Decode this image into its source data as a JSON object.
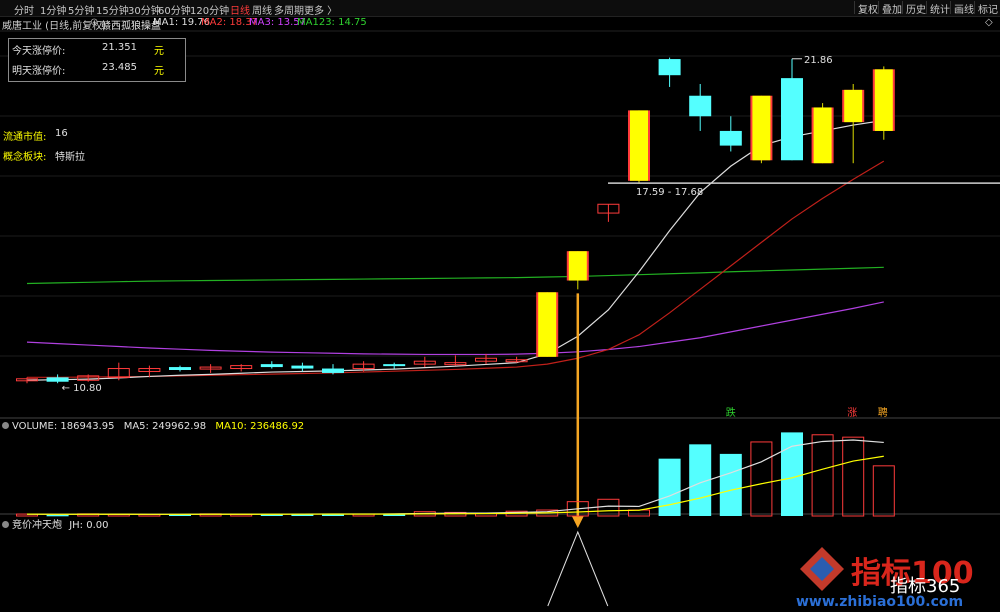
{
  "toolbar": {
    "periods": [
      {
        "label": "分时",
        "active": false
      },
      {
        "label": "1分钟",
        "active": false
      },
      {
        "label": "5分钟",
        "active": false
      },
      {
        "label": "15分钟",
        "active": false
      },
      {
        "label": "30分钟",
        "active": false
      },
      {
        "label": "60分钟",
        "active": false
      },
      {
        "label": "120分钟",
        "active": false
      },
      {
        "label": "日线",
        "active": true
      },
      {
        "label": "周线",
        "active": false
      },
      {
        "label": "多周期",
        "active": false
      },
      {
        "label": "更多 〉",
        "active": false
      }
    ],
    "right_buttons": [
      "复权",
      "叠加",
      "历史",
      "统计",
      "画线",
      "标记"
    ]
  },
  "header": {
    "stock_name": "威唐工业 (日线,前复权)",
    "indicator_name": "赣西孤狼操盘",
    "ma1": "MA1: 19.76",
    "ma2": "MA2: 18.37",
    "ma3": "MA3: 13.57",
    "ma123": "MA123: 14.75",
    "close_symbol": "◇"
  },
  "price_box": {
    "today_label": "今天涨停价:",
    "today_value": "21.351",
    "today_unit": "元",
    "tomorrow_label": "明天涨停价:",
    "tomorrow_value": "23.485",
    "tomorrow_unit": "元"
  },
  "side_info": {
    "float_cap_label": "流通市值:",
    "float_cap_value": "16",
    "concept_label": "概念板块:",
    "concept_value": "特斯拉"
  },
  "annotations": {
    "high_label": "21.86",
    "low_label": "10.80",
    "range_label": "17.59 - 17.68",
    "signal_die": "跌",
    "signal_zhang": "涨",
    "signal_mai": "聘"
  },
  "volume_header": {
    "volume": "VOLUME: 186943.95",
    "ma5": "MA5: 249962.98",
    "ma10": "MA10: 236486.92"
  },
  "indicator2_header": {
    "name": "竞价冲天炮",
    "value": "JH: 0.00"
  },
  "watermark": {
    "brand1": "指标100",
    "brand2": "指标365",
    "url": "www.zhibiao100.com"
  },
  "colors": {
    "up": "#ff3b3b",
    "down": "#54ffff",
    "ma1": "#dddddd",
    "ma2": "#c0201a",
    "ma3": "#b040e0",
    "ma123": "#22b022",
    "limit_up_fill": "#ffff00",
    "arrow": "#f5a623"
  },
  "chart_data": {
    "type": "candlestick",
    "candles": [
      {
        "o": 10.9,
        "h": 11.0,
        "l": 10.8,
        "c": 10.95
      },
      {
        "o": 11.0,
        "h": 11.1,
        "l": 10.8,
        "c": 10.85
      },
      {
        "o": 10.9,
        "h": 11.1,
        "l": 10.85,
        "c": 11.05
      },
      {
        "o": 11.0,
        "h": 11.5,
        "l": 10.9,
        "c": 11.3
      },
      {
        "o": 11.2,
        "h": 11.4,
        "l": 11.0,
        "c": 11.3
      },
      {
        "o": 11.35,
        "h": 11.4,
        "l": 11.2,
        "c": 11.25
      },
      {
        "o": 11.3,
        "h": 11.45,
        "l": 11.15,
        "c": 11.35
      },
      {
        "o": 11.3,
        "h": 11.45,
        "l": 11.2,
        "c": 11.4
      },
      {
        "o": 11.45,
        "h": 11.55,
        "l": 11.3,
        "c": 11.35
      },
      {
        "o": 11.4,
        "h": 11.5,
        "l": 11.2,
        "c": 11.3
      },
      {
        "o": 11.3,
        "h": 11.45,
        "l": 11.1,
        "c": 11.15
      },
      {
        "o": 11.3,
        "h": 11.55,
        "l": 11.2,
        "c": 11.45
      },
      {
        "o": 11.45,
        "h": 11.5,
        "l": 11.3,
        "c": 11.4
      },
      {
        "o": 11.45,
        "h": 11.7,
        "l": 11.35,
        "c": 11.55
      },
      {
        "o": 11.5,
        "h": 11.75,
        "l": 11.4,
        "c": 11.5
      },
      {
        "o": 11.55,
        "h": 11.8,
        "l": 11.45,
        "c": 11.65
      },
      {
        "o": 11.6,
        "h": 11.7,
        "l": 11.5,
        "c": 11.6
      },
      {
        "o": 11.7,
        "h": 13.9,
        "l": 11.7,
        "c": 13.9
      },
      {
        "o": 14.3,
        "h": 15.3,
        "l": 14.0,
        "c": 15.3
      },
      {
        "o": 16.6,
        "h": 16.9,
        "l": 16.3,
        "c": 16.9
      },
      {
        "o": 17.7,
        "h": 20.1,
        "l": 17.6,
        "c": 20.1
      },
      {
        "o": 21.85,
        "h": 21.9,
        "l": 20.9,
        "c": 21.3
      },
      {
        "o": 20.6,
        "h": 21.0,
        "l": 19.4,
        "c": 19.9
      },
      {
        "o": 19.4,
        "h": 19.9,
        "l": 18.7,
        "c": 18.9
      },
      {
        "o": 18.4,
        "h": 20.6,
        "l": 18.3,
        "c": 20.6
      },
      {
        "o": 21.2,
        "h": 21.86,
        "l": 18.4,
        "c": 18.4
      },
      {
        "o": 18.3,
        "h": 20.35,
        "l": 18.3,
        "c": 20.2
      },
      {
        "o": 19.7,
        "h": 21.0,
        "l": 18.3,
        "c": 20.8
      },
      {
        "o": 19.4,
        "h": 21.6,
        "l": 19.1,
        "c": 21.5
      }
    ],
    "ma1": [
      10.9,
      10.92,
      10.94,
      10.98,
      11.03,
      11.07,
      11.1,
      11.14,
      11.18,
      11.2,
      11.22,
      11.25,
      11.28,
      11.33,
      11.38,
      11.44,
      11.5,
      11.8,
      12.4,
      13.3,
      14.6,
      16.0,
      17.3,
      18.2,
      18.9,
      19.2,
      19.4,
      19.6,
      19.76
    ],
    "ma2": [
      11.0,
      11.0,
      11.01,
      11.02,
      11.03,
      11.05,
      11.07,
      11.09,
      11.11,
      11.13,
      11.15,
      11.18,
      11.21,
      11.24,
      11.27,
      11.31,
      11.35,
      11.45,
      11.65,
      11.95,
      12.45,
      13.2,
      14.0,
      14.8,
      15.6,
      16.4,
      17.1,
      17.75,
      18.37
    ],
    "ma3": [
      12.2,
      12.15,
      12.1,
      12.05,
      12.0,
      11.96,
      11.92,
      11.89,
      11.86,
      11.84,
      11.82,
      11.8,
      11.79,
      11.78,
      11.78,
      11.78,
      11.79,
      11.82,
      11.87,
      11.95,
      12.05,
      12.2,
      12.35,
      12.55,
      12.75,
      12.95,
      13.15,
      13.35,
      13.57
    ],
    "ma123": [
      14.2,
      14.22,
      14.24,
      14.26,
      14.28,
      14.29,
      14.3,
      14.31,
      14.32,
      14.33,
      14.34,
      14.35,
      14.36,
      14.37,
      14.38,
      14.39,
      14.4,
      14.42,
      14.44,
      14.47,
      14.5,
      14.53,
      14.56,
      14.6,
      14.63,
      14.66,
      14.69,
      14.72,
      14.75
    ],
    "volume": [
      8000,
      5000,
      9000,
      7000,
      6000,
      8000,
      9000,
      7000,
      8000,
      9000,
      10000,
      8000,
      9000,
      18000,
      15000,
      12000,
      20000,
      25000,
      60000,
      70000,
      25000,
      240000,
      300000,
      260000,
      310000,
      350000,
      340000,
      330000,
      210000
    ],
    "vol_ma5": [
      8000,
      7000,
      7600,
      7300,
      7000,
      7000,
      7800,
      7600,
      7600,
      8200,
      8600,
      8600,
      8800,
      10800,
      12000,
      12400,
      14800,
      18000,
      30000,
      41400,
      40000,
      84000,
      139000,
      181000,
      227000,
      292000,
      312000,
      318000,
      308000
    ],
    "vol_ma10": [
      8000,
      7000,
      7300,
      7200,
      7100,
      7000,
      7300,
      7300,
      7400,
      7600,
      7800,
      7700,
      7900,
      8800,
      9500,
      10100,
      11300,
      13000,
      16900,
      22000,
      24000,
      47000,
      75000,
      108000,
      135000,
      160000,
      196000,
      230000,
      250000
    ],
    "jh_spike_index": 18
  }
}
